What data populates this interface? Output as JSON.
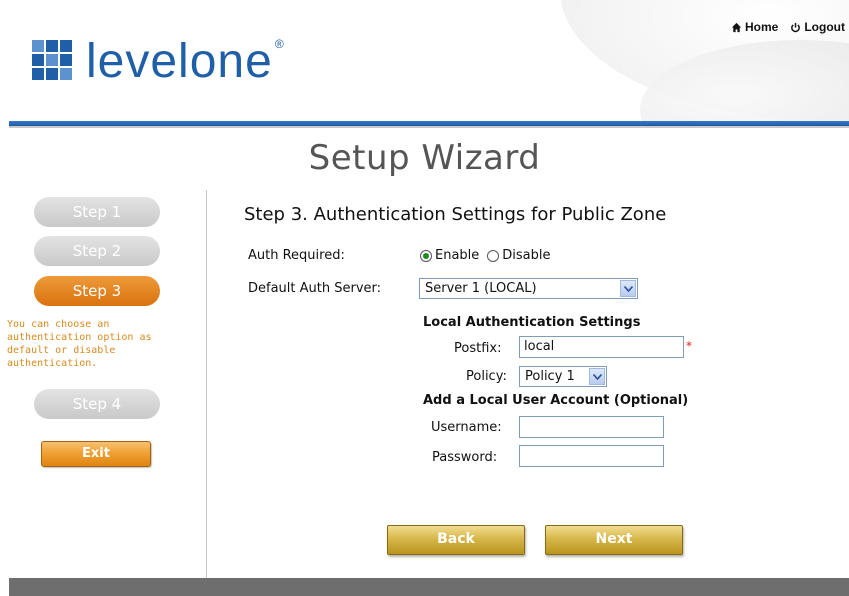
{
  "header": {
    "brand": "levelone",
    "links": {
      "home": "Home",
      "logout": "Logout"
    }
  },
  "main": {
    "title": "Setup Wizard",
    "section_title": "Step 3. Authentication Settings for Public Zone",
    "auth_required": {
      "label": "Auth Required:",
      "options": [
        "Enable",
        "Disable"
      ],
      "selected": "Enable"
    },
    "default_auth_server": {
      "label": "Default Auth Server:",
      "value": "Server 1 (LOCAL)"
    },
    "local_auth": {
      "heading": "Local Authentication Settings",
      "postfix_label": "Postfix:",
      "postfix_value": "local",
      "required_mark": "*",
      "policy_label": "Policy:",
      "policy_value": "Policy 1"
    },
    "local_user": {
      "heading": "Add a Local User Account (Optional)",
      "username_label": "Username:",
      "username_value": "",
      "password_label": "Password:",
      "password_value": ""
    },
    "buttons": {
      "back": "Back",
      "next": "Next"
    }
  },
  "sidebar": {
    "steps": [
      "Step 1",
      "Step 2",
      "Step 3",
      "Step 4"
    ],
    "active_step": "Step 3",
    "note": "You can choose an authentication option as default or disable authentication.",
    "exit": "Exit"
  },
  "colors": {
    "brand_blue": "#1f5fa8",
    "active_orange": "#d9730e",
    "gold": "#c9a431"
  }
}
